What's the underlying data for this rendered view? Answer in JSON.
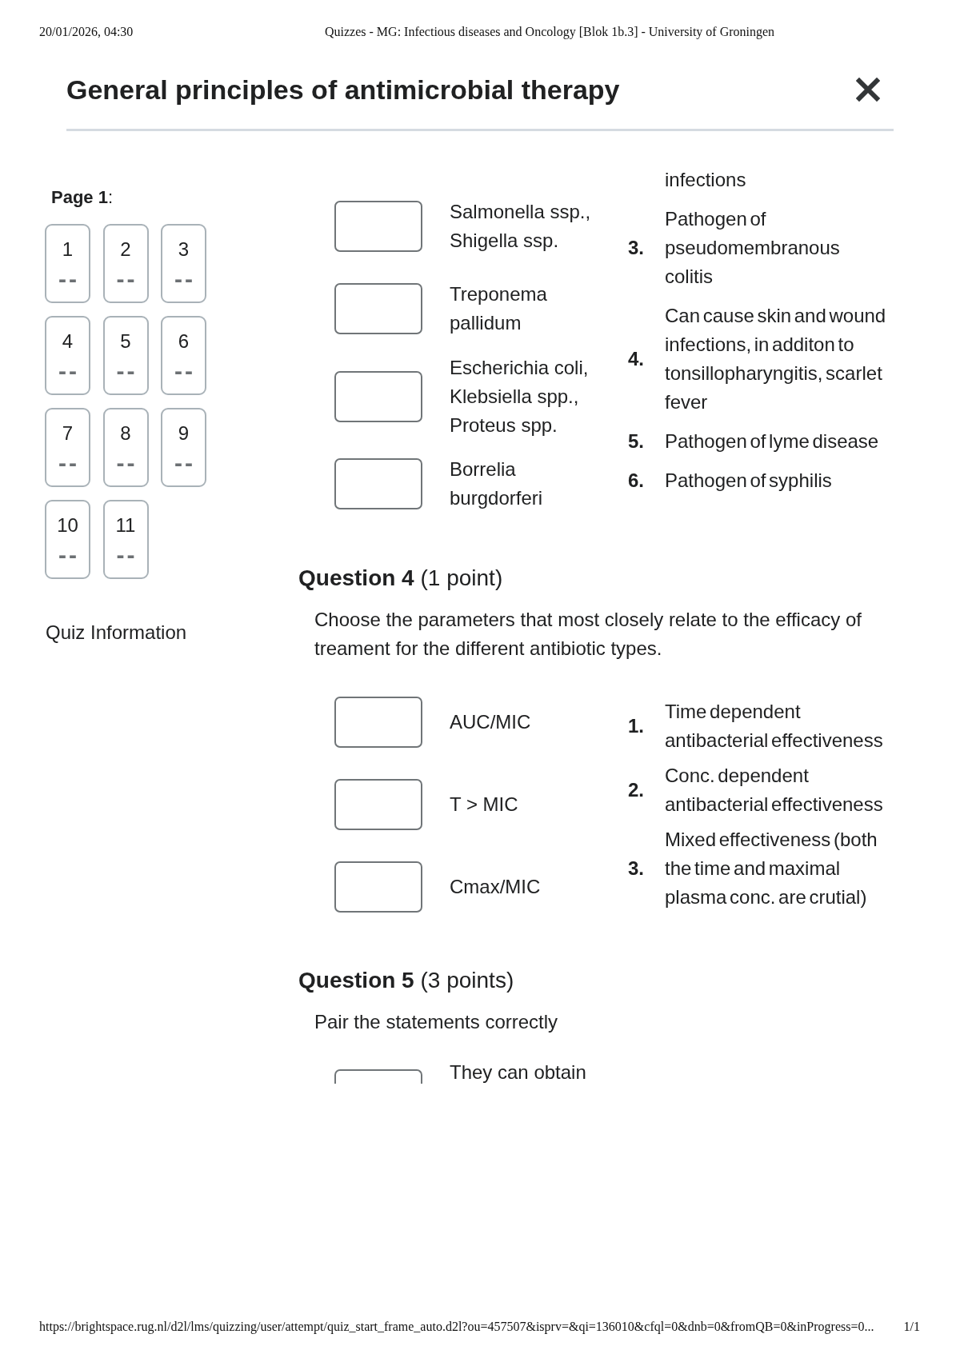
{
  "print_header": {
    "date": "20/01/2026, 04:30",
    "title": "Quizzes - MG: Infectious diseases and Oncology [Blok 1b.3] - University of Groningen"
  },
  "dialog": {
    "title": "General principles of antimicrobial therapy"
  },
  "sidebar": {
    "page_label": "**Page 1**:",
    "questions": [
      {
        "number": "1",
        "status": "--"
      },
      {
        "number": "2",
        "status": "--"
      },
      {
        "number": "3",
        "status": "--"
      },
      {
        "number": "4",
        "status": "--"
      },
      {
        "number": "5",
        "status": "--"
      },
      {
        "number": "6",
        "status": "--"
      },
      {
        "number": "7",
        "status": "--"
      },
      {
        "number": "8",
        "status": "--"
      },
      {
        "number": "9",
        "status": "--"
      },
      {
        "number": "10",
        "status": "--"
      },
      {
        "number": "11",
        "status": "--"
      }
    ],
    "quiz_information": "Quiz Information"
  },
  "questions": [
    {
      "kind": "continued",
      "matches": [
        {
          "label": "Salmonella ssp., Shigella ssp."
        },
        {
          "label": "Treponema pallidum"
        },
        {
          "label": "Escherichia coli, Klebsiella spp., Proteus spp."
        },
        {
          "label": "Borrelia burgdorferi"
        }
      ],
      "answers": [
        {
          "text": "infections"
        },
        {
          "number": "3.",
          "text": "Pathogen of pseudomembranous colitis"
        },
        {
          "number": "4.",
          "text": "Can cause skin and wound infections, in additon to tonsillopharyngitis, scarlet fever"
        },
        {
          "number": "5.",
          "text": "Pathogen of lyme disease"
        },
        {
          "number": "6.",
          "text": "Pathogen of syphilis"
        }
      ]
    },
    {
      "kind": "question",
      "title": "**Question 4** (1 point)",
      "prompt": "Choose the parameters that most closely relate to the efficacy of treament for the different antibiotic types.",
      "matches": [
        {
          "label": "AUC/MIC"
        },
        {
          "label": "T > MIC"
        },
        {
          "label": "Cmax/MIC"
        }
      ],
      "answers": [
        {
          "number": "1.",
          "text": "Time dependent antibacterial effectiveness"
        },
        {
          "number": "2.",
          "text": "Conc. dependent antibacterial effectiveness"
        },
        {
          "number": "3.",
          "text": "Mixed effectiveness (both the time and maximal plasma conc. are crutial)"
        }
      ]
    },
    {
      "kind": "cut",
      "title": "**Question 5** (3 points)",
      "prompt": "Pair the statements correctly",
      "matches": [
        {
          "label": "They can obtain"
        }
      ]
    }
  ],
  "print_footer": {
    "url": "https://brightspace.rug.nl/d2l/lms/quizzing/user/attempt/quiz_start_frame_auto.d2l?ou=457507&isprv=&qi=136010&cfql=0&dnb=0&fromQB=0&inProgress=0...",
    "page": "1/1"
  }
}
